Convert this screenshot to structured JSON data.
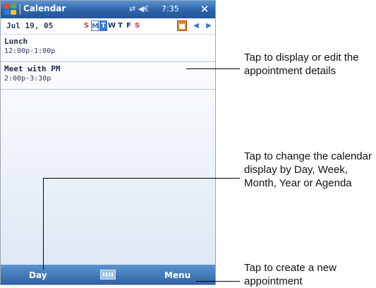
{
  "titlebar": {
    "app_title": "Calendar",
    "status_icons": "⇄ ◀€",
    "time": "7:35",
    "close_label": "✕"
  },
  "datebar": {
    "date": "Jul 19, 05",
    "weekdays": [
      {
        "label": "S",
        "color": "#d33b3b",
        "state": "normal"
      },
      {
        "label": "M",
        "color": "#3b79c8",
        "state": "selected"
      },
      {
        "label": "T",
        "color": "#ffffff",
        "state": "today"
      },
      {
        "label": "W",
        "color": "#223355",
        "state": "normal"
      },
      {
        "label": "T",
        "color": "#223355",
        "state": "normal"
      },
      {
        "label": "F",
        "color": "#223355",
        "state": "normal"
      },
      {
        "label": "S",
        "color": "#d33b3b",
        "state": "normal"
      }
    ],
    "prev_label": "◀",
    "next_label": "▶"
  },
  "appointments": [
    {
      "title": "Lunch",
      "time": "12:00p-1:00p"
    },
    {
      "title": "Meet with PM",
      "time": "2:00p-3:30p"
    }
  ],
  "bottombar": {
    "left_label": "Day",
    "right_label": "Menu"
  },
  "callouts": {
    "details": "Tap to display or edit the appointment details",
    "views": "Tap to change the calendar display by Day, Week, Month, Year or Agenda",
    "create": "Tap to create a new appointment"
  },
  "colors": {
    "accent": "#3b79c8",
    "bar_dark": "#2c5fa3"
  }
}
